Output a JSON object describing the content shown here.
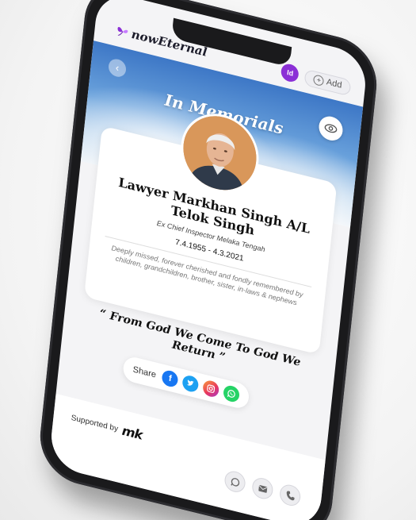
{
  "app": {
    "name": "nowEternal"
  },
  "header": {
    "avatar_initials": "Id",
    "add_label": "Add",
    "colors": {
      "avatar": "#8b2fd6"
    }
  },
  "banner": {
    "title": "In Memorials",
    "back_icon": "chevron-left-icon",
    "action_icon": "eye-icon"
  },
  "profile": {
    "name": "Lawyer Markhan Singh A/L Telok Singh",
    "role": "Ex Chief Inspector Melaka Tengah",
    "dates": "7.4.1955 - 4.3.2021",
    "tribute": "Deeply missed, forever cherished and fondly remembered by children, grandchildren, brother, sister, in-laws & nephews"
  },
  "quote": {
    "text": "“ From God We Come To God We Return ”"
  },
  "share": {
    "label": "Share",
    "icons": [
      "facebook-icon",
      "twitter-icon",
      "instagram-icon",
      "whatsapp-icon"
    ],
    "colors": {
      "facebook": "#1877f2",
      "twitter": "#1da1f2",
      "whatsapp": "#25d366"
    }
  },
  "footer": {
    "supported_label": "Supported by",
    "sponsor_logo_text": "mk",
    "contact_icons": [
      "whatsapp-icon",
      "mail-icon",
      "phone-icon"
    ]
  }
}
